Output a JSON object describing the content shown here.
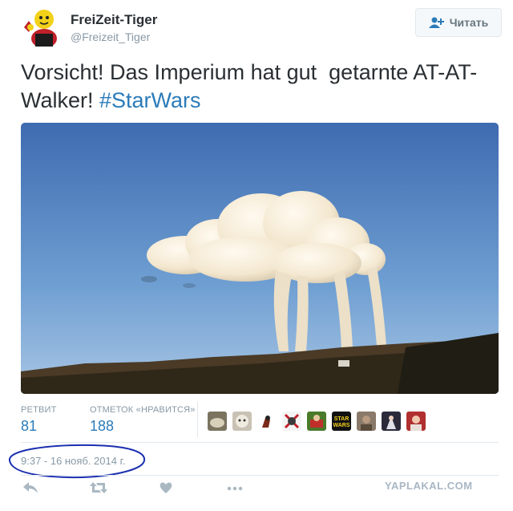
{
  "user": {
    "name": "FreiZeit-Tiger",
    "handle": "@Freizeit_Tiger"
  },
  "follow_button": {
    "label": "Читать",
    "icon": "add-user-icon"
  },
  "tweet": {
    "text": "Vorsicht! Das Imperium hat gut  getarnte AT-AT-Walker! ",
    "hashtag": "#StarWars"
  },
  "photo": {
    "subject": "cloud-walker-photo"
  },
  "stats": {
    "retweets_label": "РЕТВИТ",
    "retweets_count": "81",
    "likes_label": "ОТМЕТОК «НРАВИТСЯ»",
    "likes_count": "188"
  },
  "liked_by_avatars": 10,
  "timestamp": "9:37 - 16 нояб. 2014 г.",
  "actions": [
    "reply-icon",
    "retweet-icon",
    "like-icon",
    "more-icon"
  ],
  "watermark": "YAPLAKAL.COM",
  "colors": {
    "link": "#2b7bb9",
    "muted": "#8899a6",
    "text": "#292f33",
    "annotation": "#1a2fb0"
  }
}
